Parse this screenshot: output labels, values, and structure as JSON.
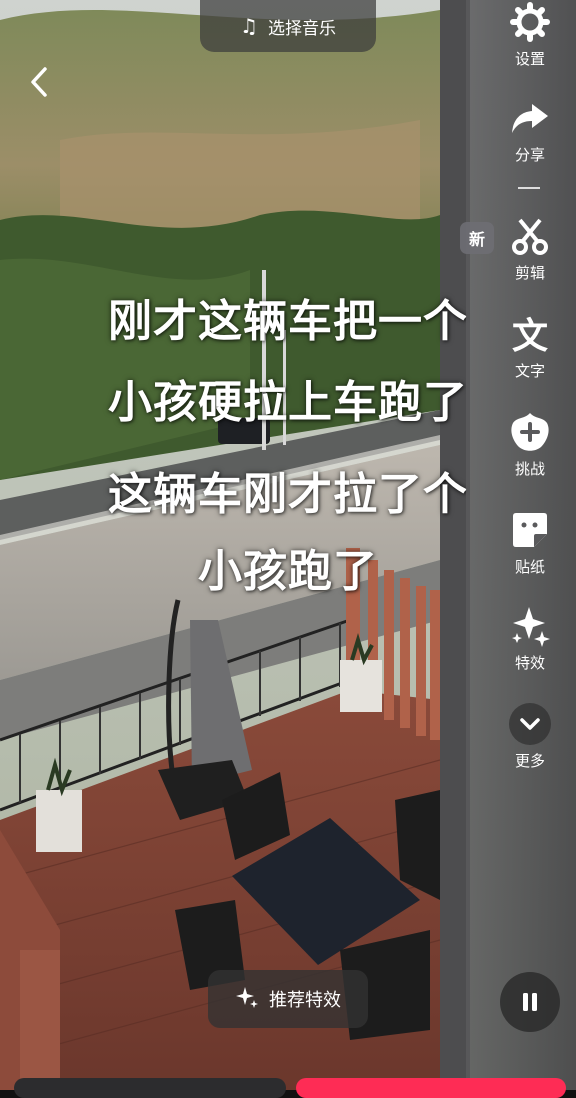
{
  "top": {
    "music_label": "选择音乐",
    "music_icon": "music-note-icon",
    "back_icon": "back-arrow-icon"
  },
  "captions": [
    "刚才这辆车把一个",
    "小孩硬拉上车跑了",
    "这辆车刚才拉了个",
    "小孩跑了"
  ],
  "toolbar": {
    "new_badge": "新",
    "items": [
      {
        "label": "设置",
        "icon": "gear-icon"
      },
      {
        "label": "分享",
        "icon": "share-icon"
      },
      {
        "label": "剪辑",
        "icon": "scissors-icon"
      },
      {
        "label": "文字",
        "icon": "text-icon"
      },
      {
        "label": "挑战",
        "icon": "challenge-icon"
      },
      {
        "label": "贴纸",
        "icon": "sticker-icon"
      },
      {
        "label": "特效",
        "icon": "sparkle-icon"
      },
      {
        "label": "更多",
        "icon": "chevron-down-icon"
      }
    ]
  },
  "bottom": {
    "recommend_effect": "推荐特效",
    "pause_icon": "pause-icon"
  },
  "colors": {
    "accent": "#fe2c55",
    "toolbar_bg": "#5a5a5c"
  }
}
